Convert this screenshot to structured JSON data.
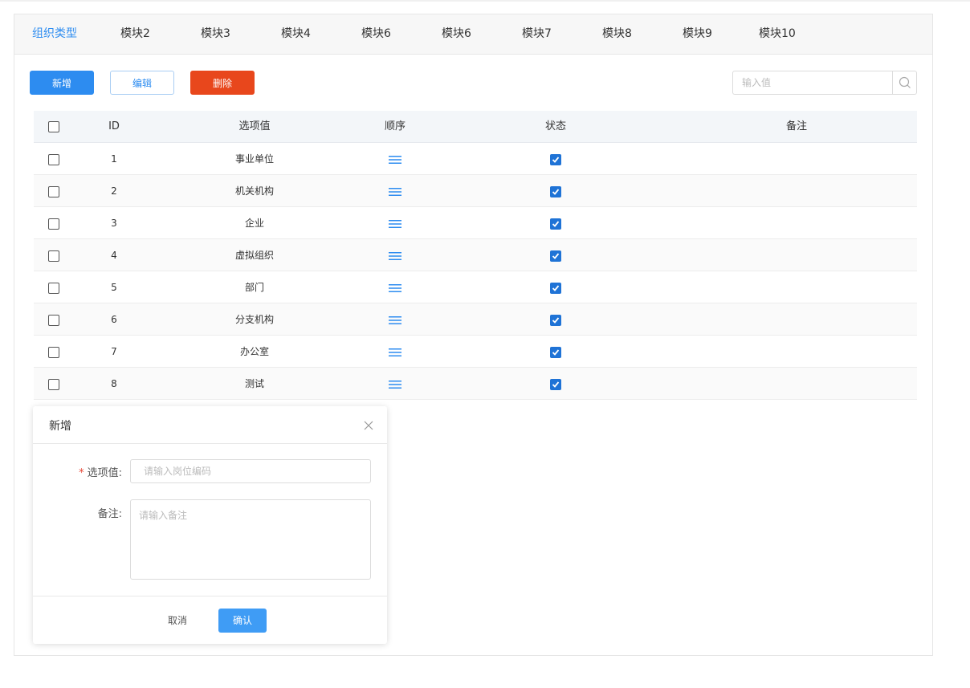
{
  "tabs": [
    {
      "label": "组织类型",
      "active": true
    },
    {
      "label": "模块2"
    },
    {
      "label": "模块3"
    },
    {
      "label": "模块4"
    },
    {
      "label": "模块6"
    },
    {
      "label": "模块6"
    },
    {
      "label": "模块7"
    },
    {
      "label": "模块8"
    },
    {
      "label": "模块9"
    },
    {
      "label": "模块10"
    }
  ],
  "toolbar": {
    "new_label": "新增",
    "edit_label": "编辑",
    "delete_label": "删除",
    "search_placeholder": "输入值"
  },
  "table": {
    "headers": {
      "id": "ID",
      "value": "选项值",
      "order": "顺序",
      "status": "状态",
      "note": "备注"
    },
    "rows": [
      {
        "id": "1",
        "value": "事业单位",
        "status": true,
        "note": ""
      },
      {
        "id": "2",
        "value": "机关机构",
        "status": true,
        "note": ""
      },
      {
        "id": "3",
        "value": "企业",
        "status": true,
        "note": ""
      },
      {
        "id": "4",
        "value": "虚拟组织",
        "status": true,
        "note": ""
      },
      {
        "id": "5",
        "value": "部门",
        "status": true,
        "note": ""
      },
      {
        "id": "6",
        "value": "分支机构",
        "status": true,
        "note": ""
      },
      {
        "id": "7",
        "value": "办公室",
        "status": true,
        "note": ""
      },
      {
        "id": "8",
        "value": "测试",
        "status": true,
        "note": ""
      }
    ]
  },
  "modal": {
    "title": "新增",
    "field_value_label": "选项值:",
    "field_value_required_mark": "*",
    "field_value_placeholder": "请输入岗位编码",
    "field_note_label": "备注:",
    "field_note_placeholder": "请输入备注",
    "cancel_label": "取消",
    "confirm_label": "确认"
  },
  "colors": {
    "accent": "#2d8cf0",
    "danger": "#e8471c",
    "checkbox_checked": "#1f73d6",
    "confirm_button": "#3f9cf5"
  },
  "icons": {
    "search": "search-icon",
    "order": "drag-handle-icon",
    "close": "close-icon",
    "check": "check-icon"
  }
}
